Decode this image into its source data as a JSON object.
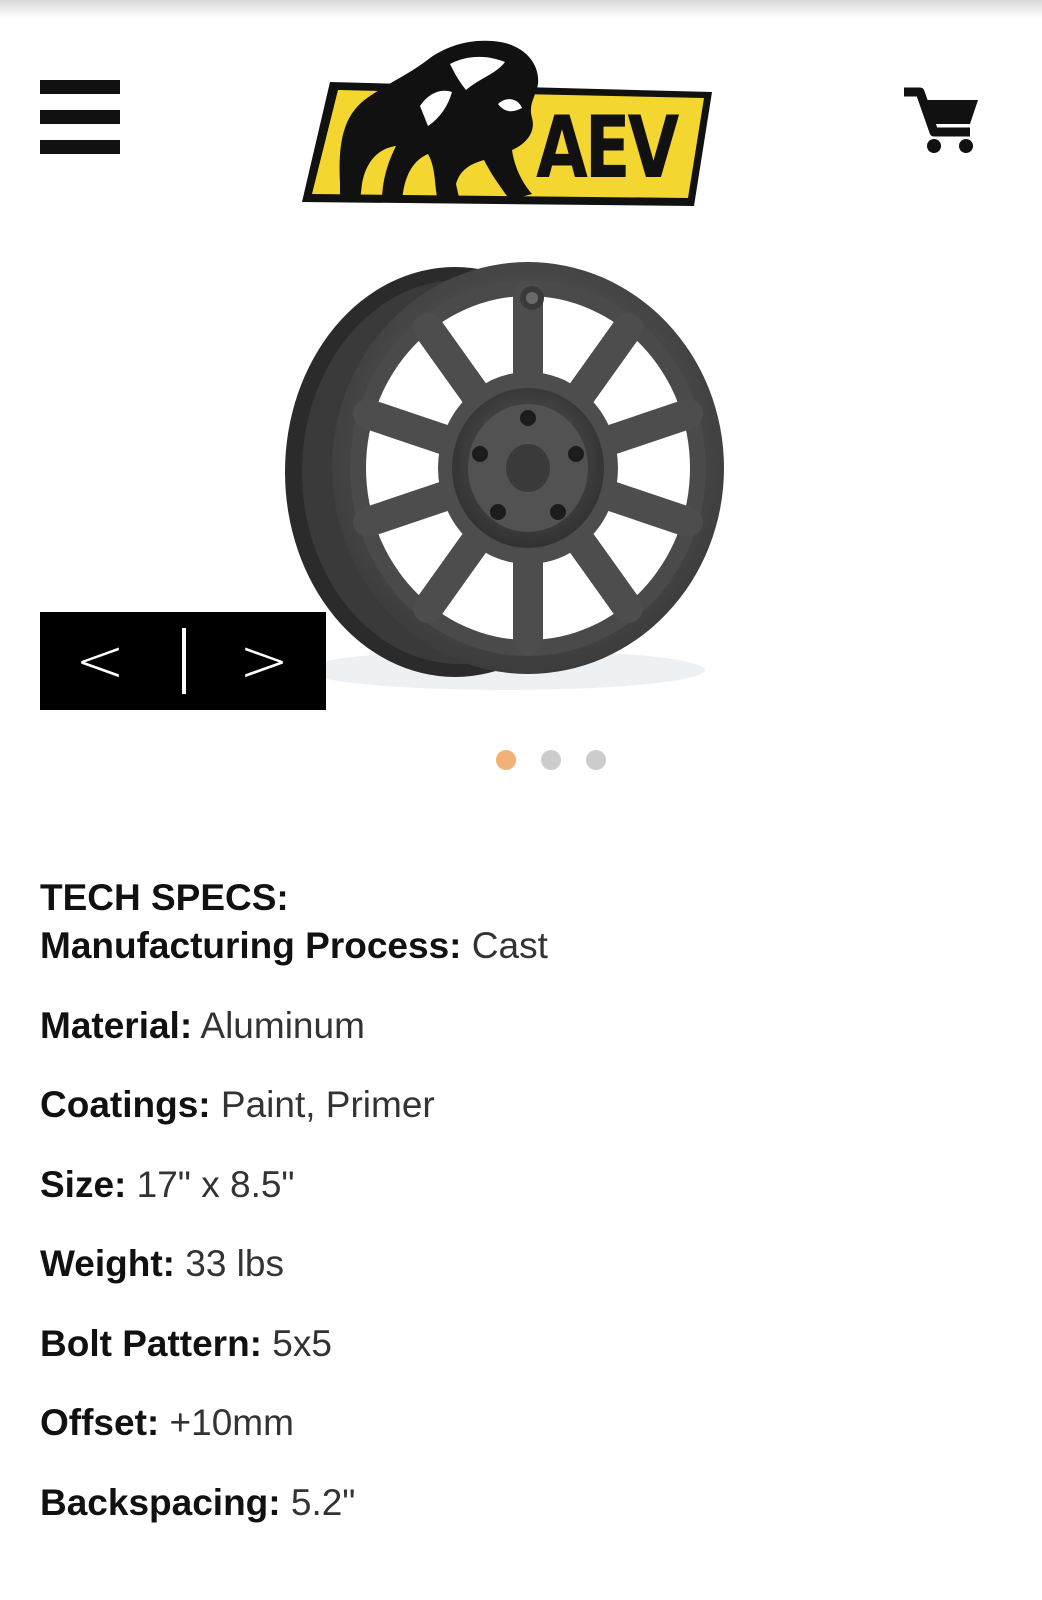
{
  "header": {
    "menu_icon": "hamburger-menu-icon",
    "cart_icon": "shopping-cart-icon",
    "logo": {
      "text": "AEV",
      "colors": {
        "yellow": "#F3D630",
        "black": "#111111"
      }
    }
  },
  "gallery": {
    "prev_label": "<",
    "next_label": ">",
    "slide_count": 3,
    "active_slide": 1,
    "dot_colors": {
      "active": "#F2B277",
      "inactive": "#CCCCCC"
    }
  },
  "specs": {
    "heading": "TECH SPECS:",
    "rows": [
      {
        "label": "Manufacturing Process:",
        "value": "Cast"
      },
      {
        "label": "Material:",
        "value": "Aluminum"
      },
      {
        "label": "Coatings:",
        "value": "Paint, Primer"
      },
      {
        "label": "Size:",
        "value": "17\" x 8.5\""
      },
      {
        "label": "Weight:",
        "value": "33 lbs"
      },
      {
        "label": "Bolt Pattern:",
        "value": "5x5"
      },
      {
        "label": "Offset:",
        "value": "+10mm"
      },
      {
        "label": "Backspacing:",
        "value": "5.2\""
      }
    ]
  }
}
